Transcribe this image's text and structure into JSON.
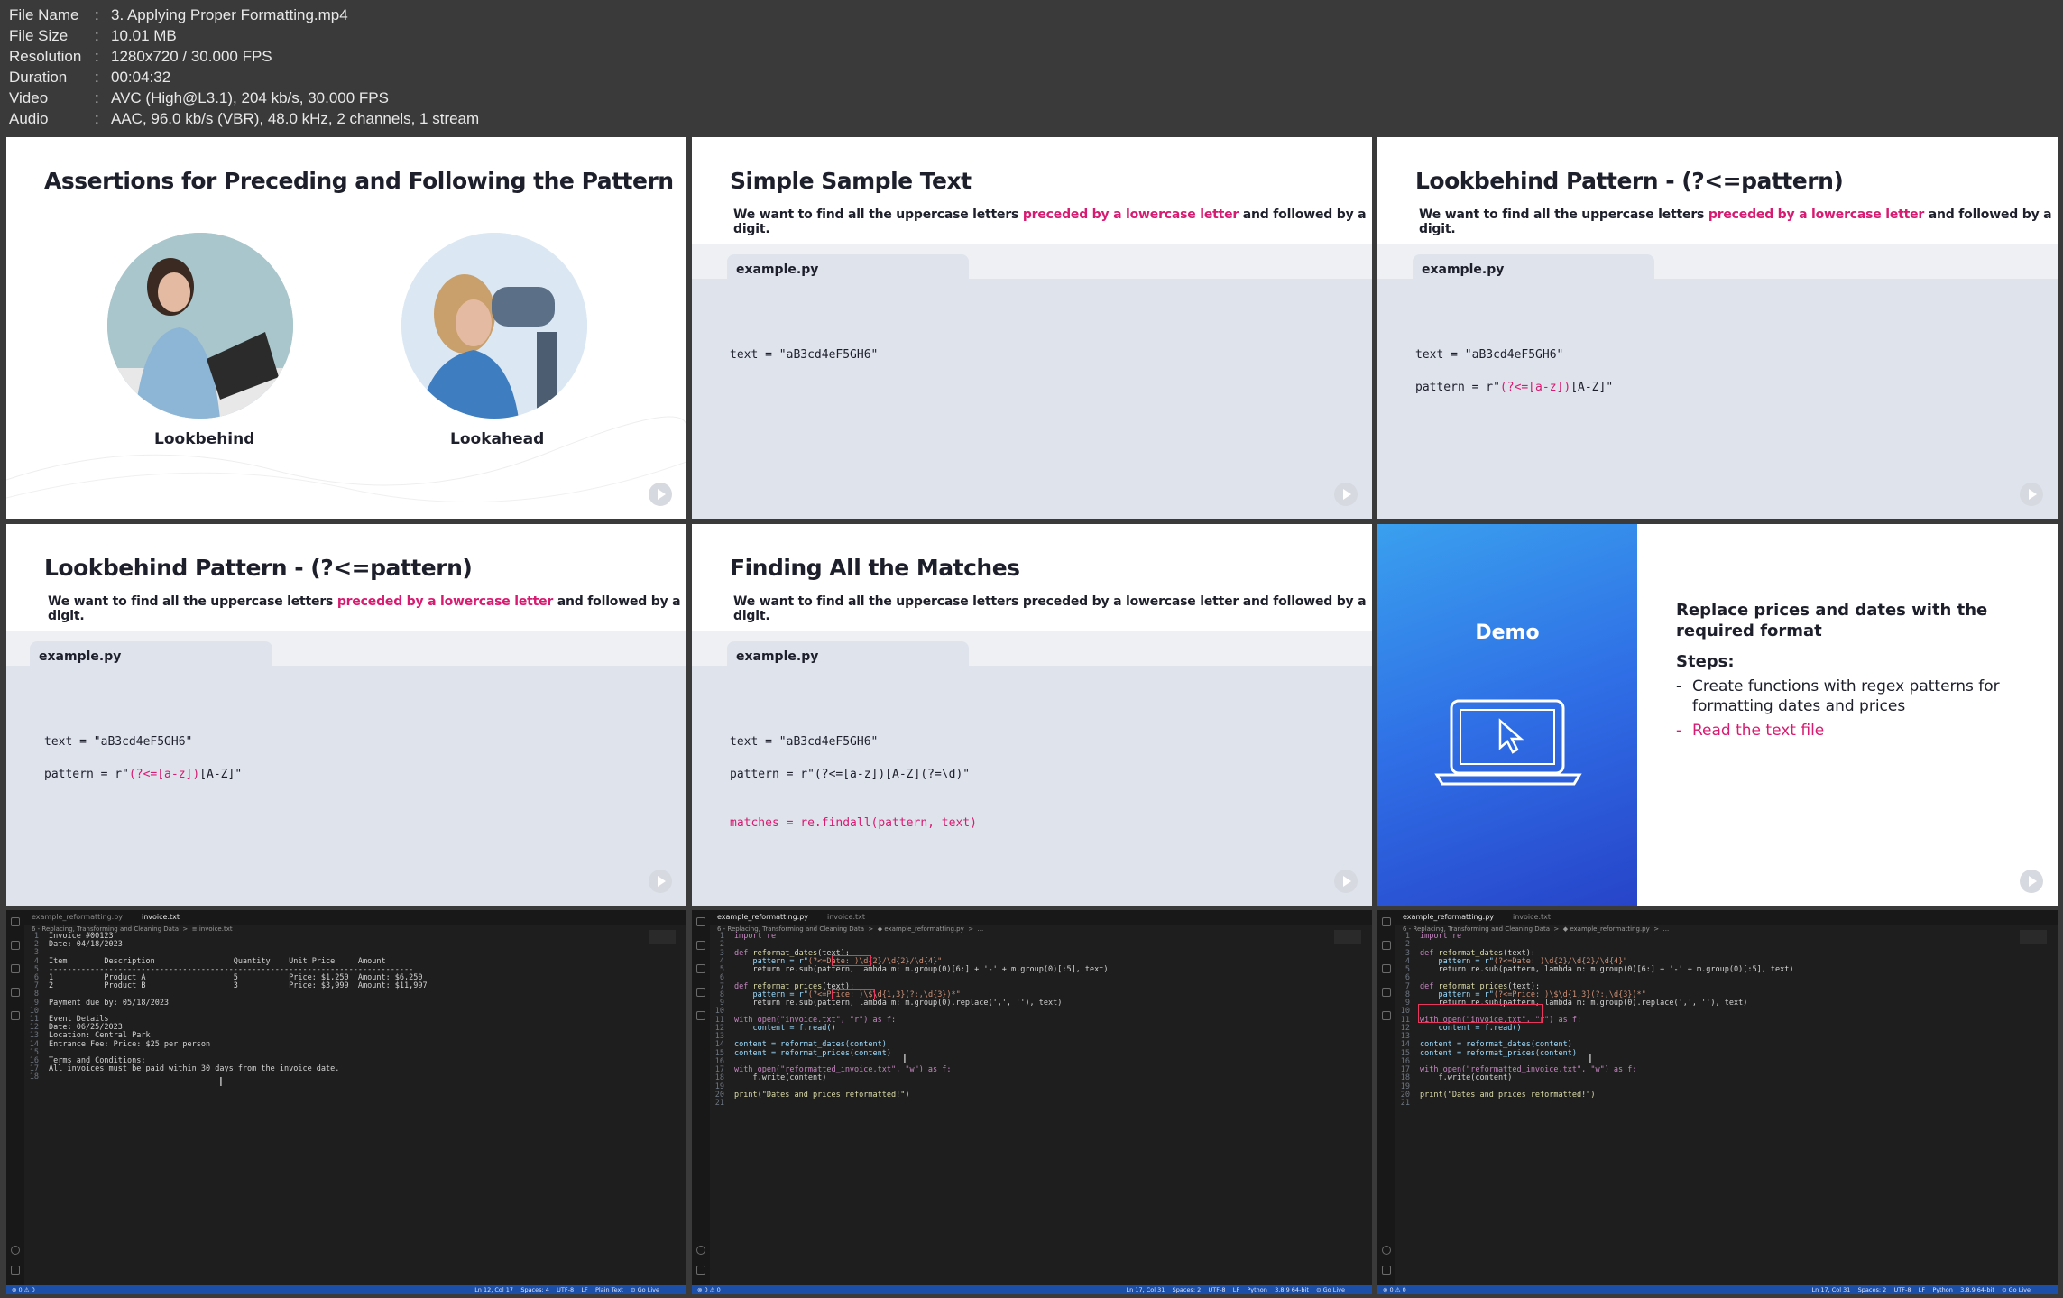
{
  "meta": {
    "rows": [
      {
        "label": "File Name",
        "value": "3. Applying Proper Formatting.mp4"
      },
      {
        "label": "File Size",
        "value": "10.01 MB"
      },
      {
        "label": "Resolution",
        "value": "1280x720 / 30.000 FPS"
      },
      {
        "label": "Duration",
        "value": "00:04:32"
      },
      {
        "label": "Video",
        "value": "AVC (High@L3.1), 204 kb/s, 30.000 FPS"
      },
      {
        "label": "Audio",
        "value": "AAC, 96.0 kb/s (VBR), 48.0 kHz, 2 channels, 1 stream"
      }
    ],
    "separator": ":"
  },
  "slide1": {
    "title": "Assertions for Preceding and Following the Pattern",
    "left_label": "Lookbehind",
    "right_label": "Lookahead"
  },
  "common": {
    "sub_a": "We want to find all the uppercase letters ",
    "sub_hl": "preceded by a lowercase letter",
    "sub_b": " and followed by a digit.",
    "sub_plain": "We want to find all the uppercase letters preceded by a lowercase letter and followed by a digit.",
    "file_tab": "example.py",
    "text_line": "text = \"aB3cd4eF5GH6\"",
    "pattern_prefix": "pattern = r\"",
    "pattern_lookbehind": "(?<=[a-z])",
    "pattern_suffix": "[A-Z]\"",
    "pattern_full": "pattern = r\"(?<=[a-z])[A-Z](?=\\d)\"",
    "matches_line": "matches = re.findall(pattern, text)"
  },
  "slide2": {
    "title": "Simple Sample Text"
  },
  "slide3": {
    "title": "Lookbehind Pattern - (?<=pattern)"
  },
  "slide4": {
    "title": "Lookbehind Pattern - (?<=pattern)"
  },
  "slide5": {
    "title": "Finding All the Matches"
  },
  "slide6": {
    "demo_label": "Demo",
    "heading": "Replace prices and dates with the required format",
    "steps_label": "Steps:",
    "step1": "Create functions with regex patterns for formatting dates and prices",
    "step2": "Read the text file",
    "dash": "-"
  },
  "ide1": {
    "tab1": "example_reformatting.py",
    "tab2": "invoice.txt",
    "crumb": "6 - Replacing, Transforming and Cleaning Data  >  ≡ invoice.txt",
    "status_left": "⊗ 0 ⚠ 0",
    "status_right": "Ln 12, Col 17    Spaces: 4    UTF-8    LF    Plain Text    ⊙ Go Live",
    "lines": [
      "Invoice #00123",
      "Date: 04/18/2023",
      "",
      "Item        Description                 Quantity    Unit Price     Amount",
      "-------------------------------------------------------------------------------",
      "1           Product A                   5           Price: $1,250  Amount: $6,250",
      "2           Product B                   3           Price: $3,999  Amount: $11,997",
      "",
      "Payment due by: 05/18/2023",
      "",
      "Event Details",
      "Date: 06/25/2023",
      "Location: Central Park",
      "Entrance Fee: Price: $25 per person",
      "",
      "Terms and Conditions:",
      "All invoices must be paid within 30 days from the invoice date.",
      ""
    ]
  },
  "ide2": {
    "tab1": "example_reformatting.py",
    "tab2": "invoice.txt",
    "crumb": "6 - Replacing, Transforming and Cleaning Data  >  ◆ example_reformatting.py  >  ...",
    "status_left": "⊗ 0 ⚠ 0",
    "status_right": "Ln 17, Col 31    Spaces: 2    UTF-8    LF    Python    3.8.9 64-bit    ⊙ Go Live"
  },
  "ide3": {
    "tab1": "example_reformatting.py",
    "tab2": "invoice.txt",
    "crumb": "6 - Replacing, Transforming and Cleaning Data  >  ◆ example_reformatting.py  >  ...",
    "status_left": "⊗ 0 ⚠ 0",
    "status_right": "Ln 17, Col 31    Spaces: 2    UTF-8    LF    Python    3.8.9 64-bit    ⊙ Go Live"
  },
  "code": {
    "l1": "import re",
    "l3a": "def ",
    "l3b": "reformat_dates",
    "l3c": "(text):",
    "l4a": "    pattern = r\"",
    "l4b": "(?<=Date: )",
    "l4c": "\\d{2}/\\d{2}/\\d{4}\"",
    "l5": "    return re.sub(pattern, lambda m: m.group(0)[6:] + '-' + m.group(0)[:5], text)",
    "l7a": "def ",
    "l7b": "reformat_prices",
    "l7c": "(text):",
    "l8a": "    pattern = r\"",
    "l8b": "(?<=Price: )",
    "l8c": "\\$\\d{1,3}(?:,\\d{3})*\"",
    "l9": "    return re.sub(pattern, lambda m: m.group(0).replace(',', ''), text)",
    "l11": "with open(\"invoice.txt\", \"r\") as f:",
    "l12": "    content = f.read()",
    "l14": "content = reformat_dates(content)",
    "l15": "content = reformat_prices(content)",
    "l17": "with open(\"reformatted_invoice.txt\", \"w\") as f:",
    "l18": "    f.write(content)",
    "l20": "print(\"Dates and prices reformatted!\")"
  },
  "colors": {
    "accent_pink": "#d81b72",
    "demo_blue": "#2f6fe6",
    "status_blue": "#1b4fa8",
    "highlight_red": "#e8365d"
  }
}
